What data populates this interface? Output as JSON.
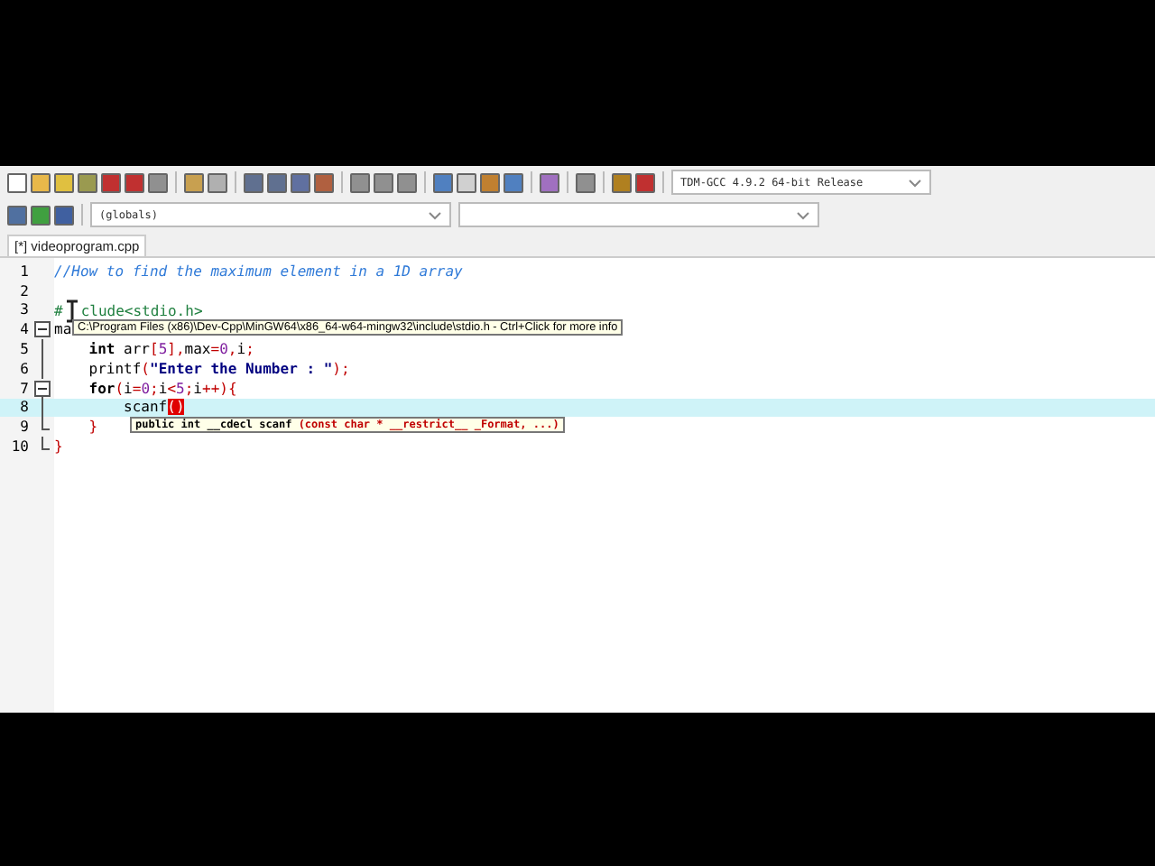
{
  "toolbar": {
    "compiler": "TDM-GCC 4.9.2 64-bit Release",
    "scope": "(globals)"
  },
  "tabs": [
    {
      "label": "[*] videoprogram.cpp",
      "selected": true
    }
  ],
  "editor": {
    "lines": [
      {
        "number": "1",
        "tokens": [
          {
            "kind": "comment",
            "text": "//How to find the maximum element in a 1D array"
          }
        ]
      },
      {
        "number": "2"
      },
      {
        "number": "3",
        "cursor": true,
        "tokens": [
          {
            "kind": "pre",
            "text": "#"
          },
          {
            "kind": "pre",
            "text": "clude<stdio.h>"
          }
        ]
      },
      {
        "number": "4",
        "fold_start": true,
        "tokens": [
          {
            "kind": "id",
            "text": "ma"
          }
        ]
      },
      {
        "number": "5",
        "tokens": [
          {
            "kind": "kw",
            "text": "    int"
          },
          {
            "kind": "id",
            "text": " arr"
          },
          {
            "kind": "sym",
            "text": "["
          },
          {
            "kind": "num",
            "text": "5"
          },
          {
            "kind": "sym",
            "text": "]"
          },
          {
            "kind": "sym",
            "text": ","
          },
          {
            "kind": "id",
            "text": "max"
          },
          {
            "kind": "sym",
            "text": "="
          },
          {
            "kind": "num",
            "text": "0"
          },
          {
            "kind": "sym",
            "text": ","
          },
          {
            "kind": "id",
            "text": "i"
          },
          {
            "kind": "sym",
            "text": ";"
          }
        ]
      },
      {
        "number": "6",
        "tokens": [
          {
            "kind": "id",
            "text": "    printf"
          },
          {
            "kind": "sym",
            "text": "("
          },
          {
            "kind": "str",
            "text": "\"Enter the Number : \""
          },
          {
            "kind": "sym",
            "text": ");"
          }
        ]
      },
      {
        "number": "7",
        "fold_start": true,
        "tokens": [
          {
            "kind": "kw",
            "text": "    for"
          },
          {
            "kind": "sym",
            "text": "("
          },
          {
            "kind": "id",
            "text": "i"
          },
          {
            "kind": "sym",
            "text": "="
          },
          {
            "kind": "num",
            "text": "0"
          },
          {
            "kind": "sym",
            "text": ";"
          },
          {
            "kind": "id",
            "text": "i"
          },
          {
            "kind": "sym",
            "text": "<"
          },
          {
            "kind": "num",
            "text": "5"
          },
          {
            "kind": "sym",
            "text": ";"
          },
          {
            "kind": "id",
            "text": "i"
          },
          {
            "kind": "sym",
            "text": "++){"
          }
        ]
      },
      {
        "number": "8",
        "current": true,
        "tokens": [
          {
            "kind": "id",
            "text": "        scanf"
          },
          {
            "kind": "match",
            "text": "()"
          }
        ]
      },
      {
        "number": "9",
        "tokens": [
          {
            "kind": "sym",
            "text": "    }"
          }
        ]
      },
      {
        "number": "10",
        "tokens": [
          {
            "kind": "sym",
            "text": "}"
          }
        ]
      }
    ],
    "include_tooltip": "C:\\Program Files (x86)\\Dev-Cpp\\MinGW64\\x86_64-w64-mingw32\\include\\stdio.h - Ctrl+Click for more info",
    "signature_tooltip": {
      "prefix": "public int __cdecl scanf ",
      "params": "(const char * __restrict__ _Format, ...)"
    }
  }
}
